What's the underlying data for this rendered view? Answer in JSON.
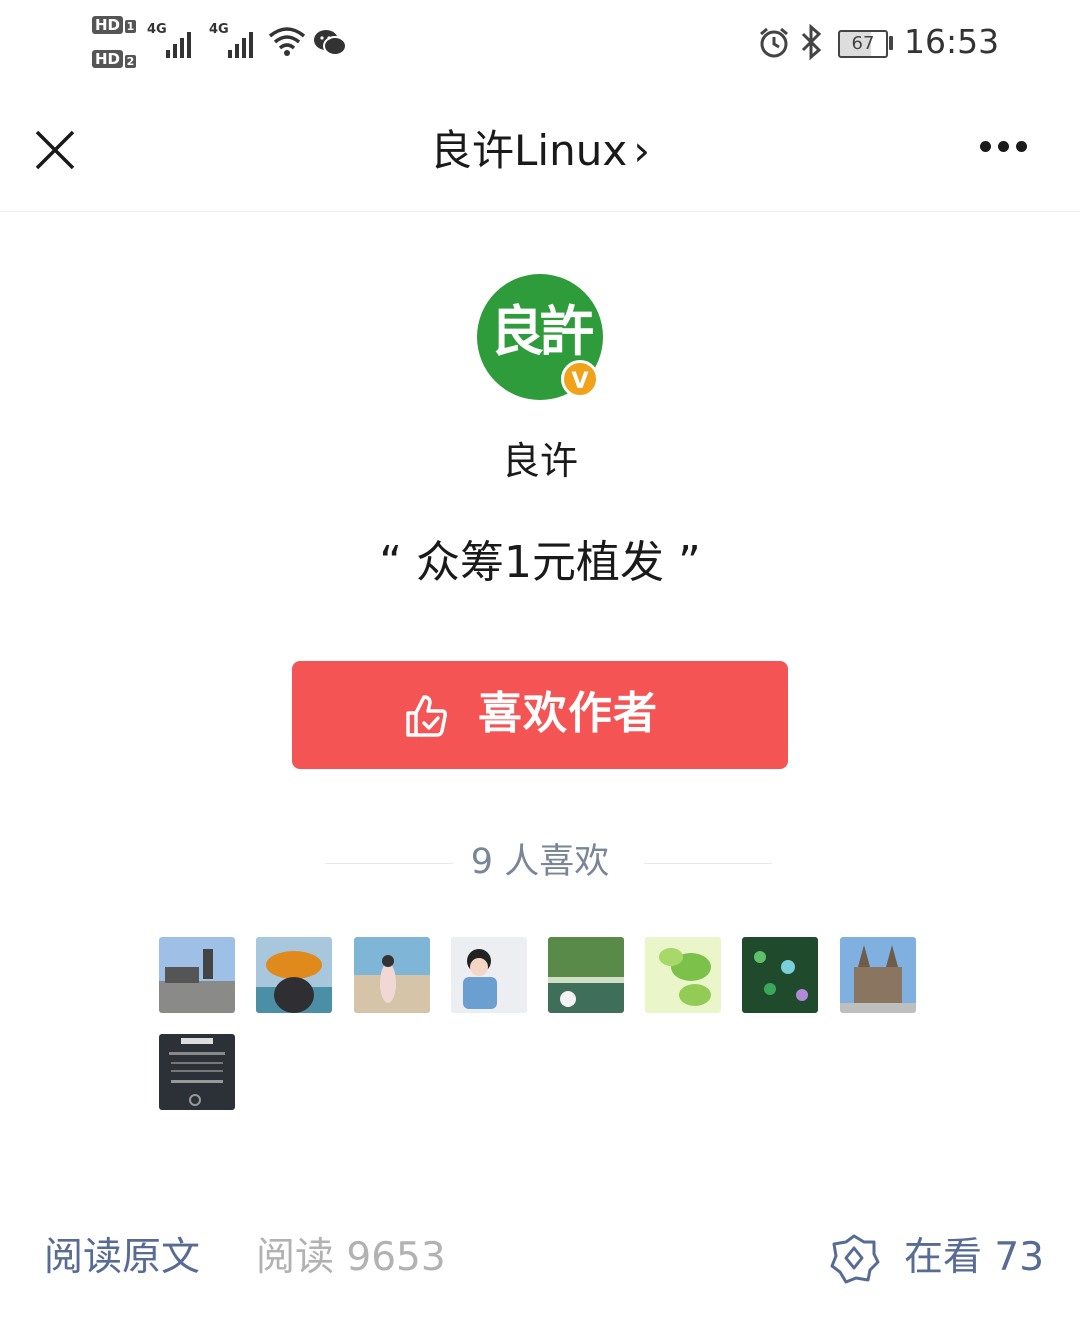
{
  "status_bar": {
    "hd1": "HD",
    "hd1_sim": "1",
    "hd2": "HD",
    "hd2_sim": "2",
    "signal1_label": "4G",
    "signal2_label": "4G",
    "battery": "67",
    "time": "16:53",
    "icons": [
      "wifi-icon",
      "wechat-icon",
      "alarm-icon",
      "bluetooth-icon",
      "battery-icon"
    ]
  },
  "nav": {
    "title": "良许Linux",
    "chevron": "›"
  },
  "profile": {
    "avatar_text": "良許",
    "verified_badge": "V",
    "name": "良许",
    "quote": "“ 众筹1元植发 ”"
  },
  "like_button": {
    "label": "喜欢作者",
    "color": "#f45454"
  },
  "likers": {
    "count_text": "9 人喜欢",
    "count": 9
  },
  "footer": {
    "read_original": "阅读原文",
    "read_count": "阅读 9653",
    "watching": "在看 73",
    "link_color": "#576b95"
  }
}
